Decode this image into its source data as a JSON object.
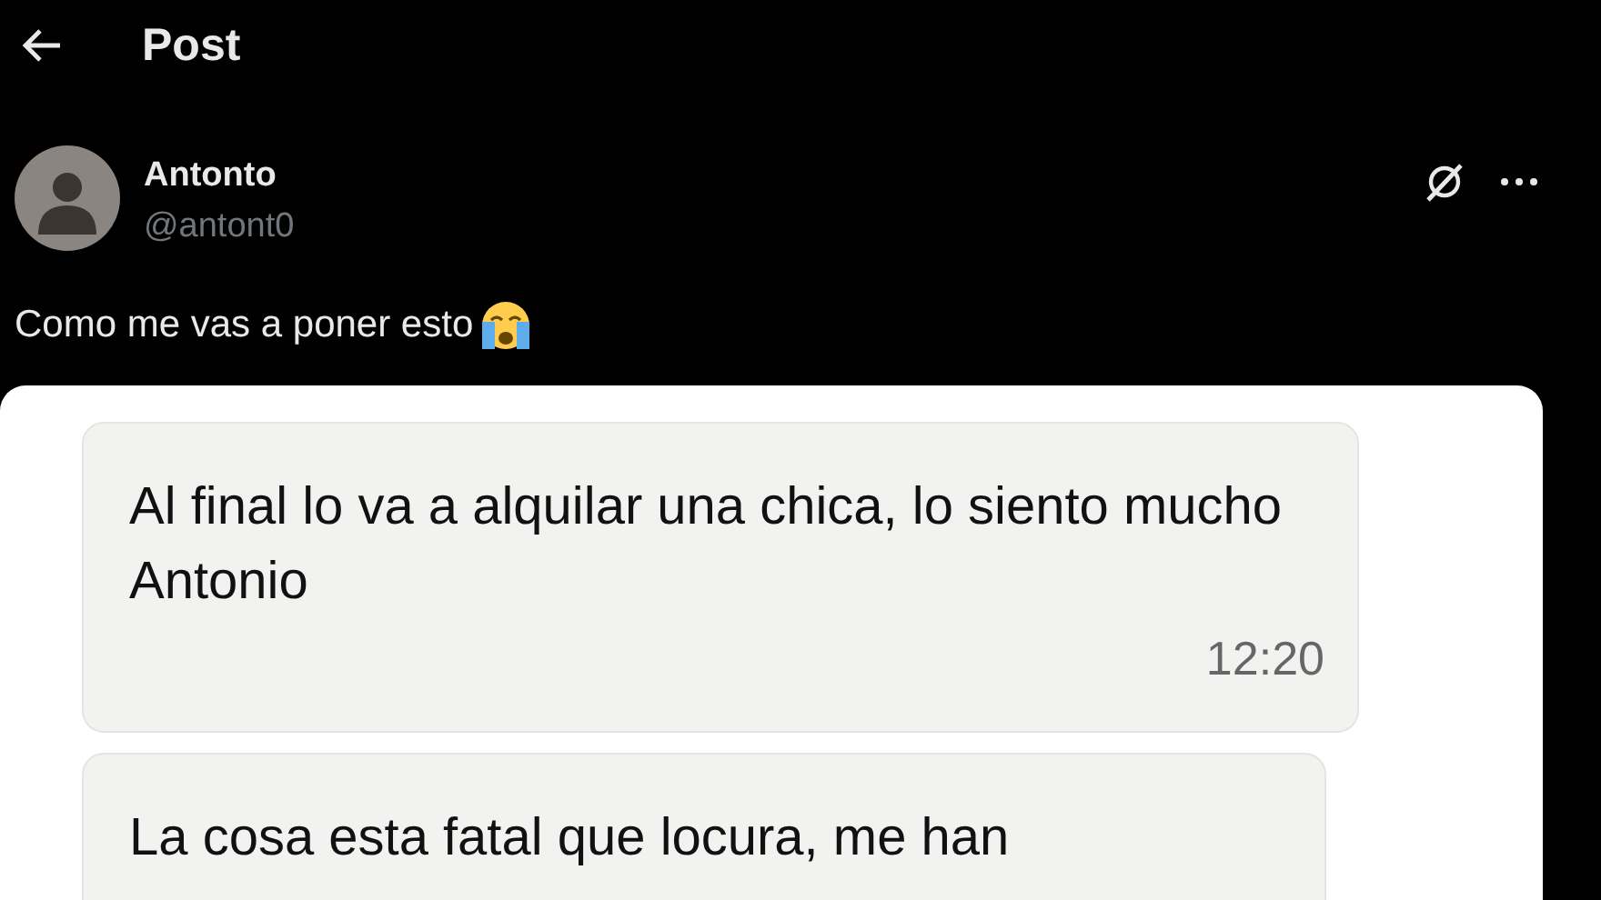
{
  "header": {
    "title": "Post"
  },
  "post": {
    "author": {
      "name": "Antonto",
      "handle": "@antont0"
    },
    "text": "Como me vas a poner esto",
    "chat": [
      {
        "text": "Al final lo va a alquilar una chica, lo siento mucho Antonio",
        "time": "12:20"
      },
      {
        "text": "La cosa esta fatal que locura, me han"
      }
    ]
  }
}
